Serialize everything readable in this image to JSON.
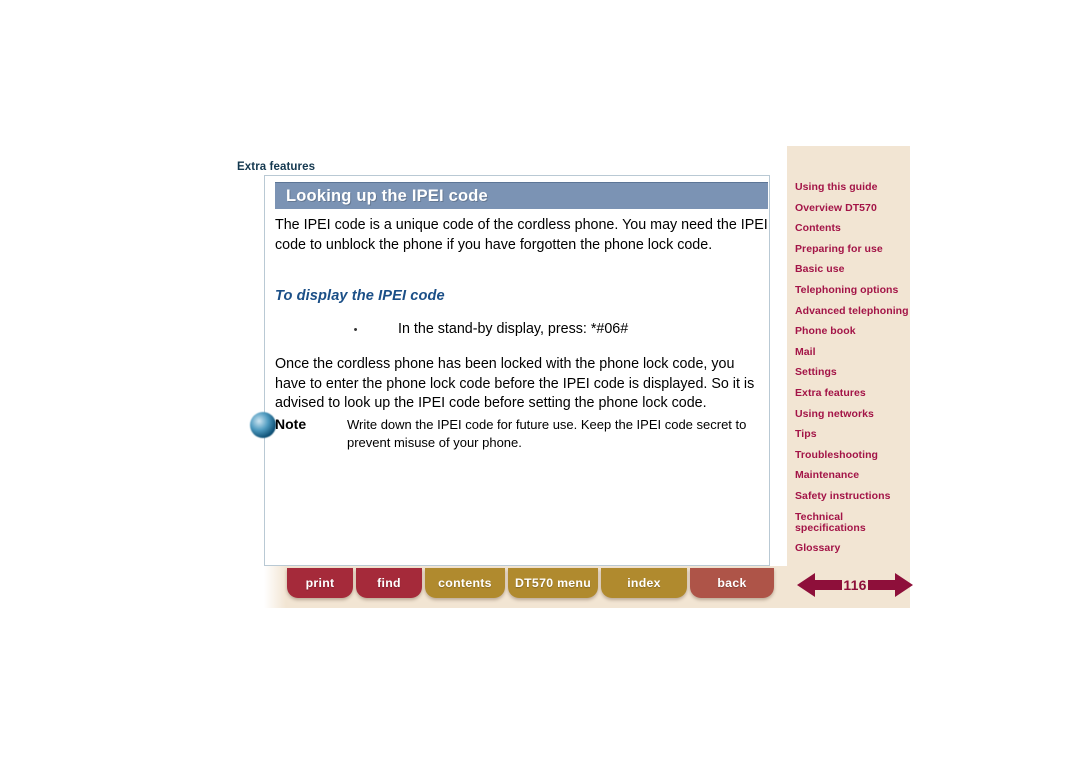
{
  "breadcrumb": "Extra features",
  "page": {
    "title": "Looking up the IPEI code",
    "intro": "The IPEI code is a unique code of the cordless phone. You may need the IPEI code to unblock the phone if you have forgotten the phone lock code.",
    "subheading": "To display the IPEI code",
    "step_bullet": "•",
    "step_text": "In the stand-by display, press: *#06#",
    "after_step": "Once the cordless phone has been locked with the phone lock code, you have to enter the phone lock code before the IPEI code is displayed. So it is advised to look up the IPEI code before setting the phone lock code.",
    "note_label": "Note",
    "note_text": "Write down the IPEI code for future use. Keep the IPEI code secret to prevent misuse of your phone."
  },
  "sidebar": {
    "items": [
      {
        "label": "Using this guide"
      },
      {
        "label": "Overview DT570"
      },
      {
        "label": "Contents"
      },
      {
        "label": "Preparing for use"
      },
      {
        "label": "Basic use"
      },
      {
        "label": "Telephoning options"
      },
      {
        "label": "Advanced telephoning"
      },
      {
        "label": "Phone book"
      },
      {
        "label": "Mail"
      },
      {
        "label": "Settings"
      },
      {
        "label": "Extra features"
      },
      {
        "label": "Using networks"
      },
      {
        "label": "Tips"
      },
      {
        "label": "Troubleshooting"
      },
      {
        "label": "Maintenance"
      },
      {
        "label": "Safety instructions"
      },
      {
        "label": "Technical\nspecifications"
      },
      {
        "label": "Glossary"
      }
    ]
  },
  "toolbar": {
    "buttons": [
      {
        "label": "print"
      },
      {
        "label": "find"
      },
      {
        "label": "contents"
      },
      {
        "label": "DT570 menu"
      },
      {
        "label": "index"
      },
      {
        "label": "back"
      }
    ]
  },
  "pager": {
    "prev_icon": "left-arrow-icon",
    "next_icon": "right-arrow-icon",
    "page_number": "116"
  },
  "colors": {
    "title_bar": "#7b93b4",
    "sidebar_bg": "#f2e5d3",
    "sidebar_link": "#a31447",
    "subheading": "#1b4f87",
    "breadcrumb": "#14384f",
    "button_red": "#a52a3a",
    "button_gold": "#b08a2e",
    "button_back": "#ae5448",
    "arrow": "#8e0f3a"
  }
}
